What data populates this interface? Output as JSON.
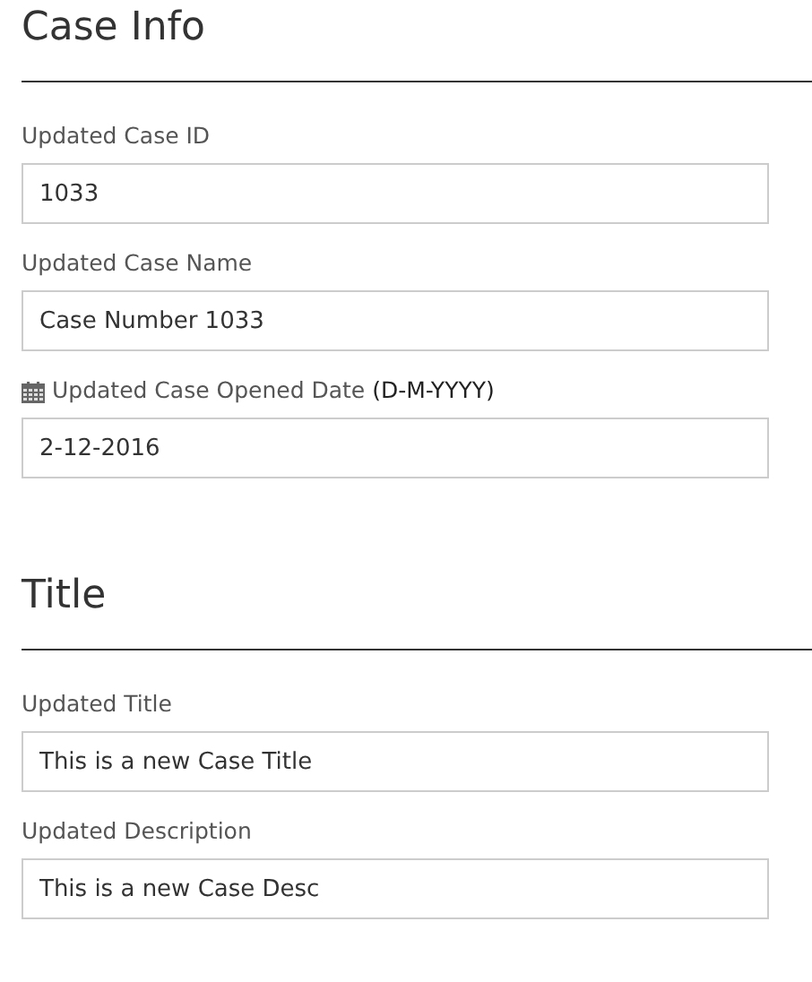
{
  "sections": [
    {
      "title": "Case Info",
      "fields": [
        {
          "label": "Updated Case ID",
          "value": "1033"
        },
        {
          "label": "Updated Case Name",
          "value": "Case Number 1033"
        },
        {
          "label": "Updated Case Opened Date",
          "kind": "date",
          "format": "(D-M-YYYY)",
          "value": "2-12-2016"
        }
      ]
    },
    {
      "title": "Title",
      "fields": [
        {
          "label": "Updated Title",
          "value": "This is a new Case Title"
        },
        {
          "label": "Updated Description",
          "value": "This is a new Case Desc"
        }
      ]
    }
  ]
}
